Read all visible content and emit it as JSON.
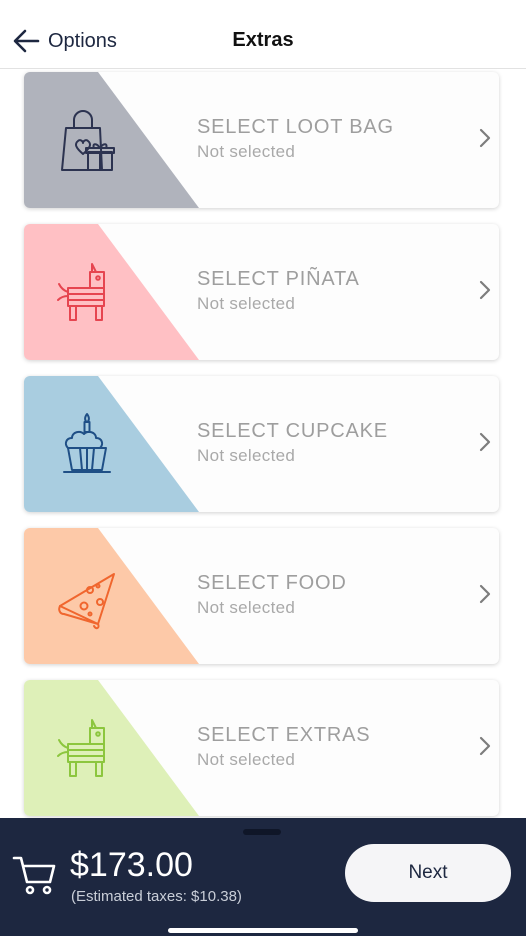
{
  "header": {
    "back_label": "Options",
    "title": "Extras"
  },
  "cards": [
    {
      "title": "SELECT LOOT BAG",
      "status": "Not selected",
      "icon": "loot-bag-icon",
      "color": "#b0b3bc",
      "icon_color": "#2c3350"
    },
    {
      "title": "SELECT PIÑATA",
      "status": "Not selected",
      "icon": "pinata-icon",
      "color": "#ffc0c4",
      "icon_color": "#e64550"
    },
    {
      "title": "SELECT CUPCAKE",
      "status": "Not selected",
      "icon": "cupcake-icon",
      "color": "#a9cde0",
      "icon_color": "#1f4f86"
    },
    {
      "title": "SELECT FOOD",
      "status": "Not selected",
      "icon": "pizza-icon",
      "color": "#fdc9a8",
      "icon_color": "#f0662e"
    },
    {
      "title": "SELECT EXTRAS",
      "status": "Not selected",
      "icon": "pinata-icon",
      "color": "#def0b8",
      "icon_color": "#8cc63e"
    }
  ],
  "footer": {
    "total": "$173.00",
    "taxes": "(Estimated taxes: $10.38)",
    "next_label": "Next",
    "background_color": "#1d2740"
  }
}
